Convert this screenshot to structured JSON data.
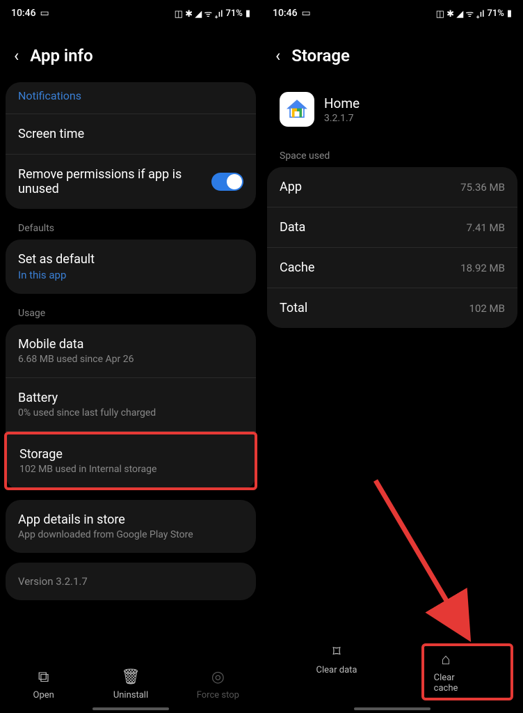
{
  "statusbar": {
    "time": "10:46",
    "battery": "71%"
  },
  "left": {
    "title": "App info",
    "notifications": "Notifications",
    "screen_time": "Screen time",
    "remove_perm": "Remove permissions if app is unused",
    "defaults_label": "Defaults",
    "set_default": "Set as default",
    "in_this_app": "In this app",
    "usage_label": "Usage",
    "mobile_data": "Mobile data",
    "mobile_data_sub": "6.68 MB used since Apr 26",
    "battery": "Battery",
    "battery_sub": "0% used since last fully charged",
    "storage": "Storage",
    "storage_sub": "102 MB used in Internal storage",
    "details": "App details in store",
    "details_sub": "App downloaded from Google Play Store",
    "version": "Version 3.2.1.7",
    "nav": {
      "open": "Open",
      "uninstall": "Uninstall",
      "force": "Force stop"
    }
  },
  "right": {
    "title": "Storage",
    "app_name": "Home",
    "app_version": "3.2.1.7",
    "space_used": "Space used",
    "rows": {
      "app": {
        "label": "App",
        "value": "75.36 MB"
      },
      "data": {
        "label": "Data",
        "value": "7.41 MB"
      },
      "cache": {
        "label": "Cache",
        "value": "18.92 MB"
      },
      "total": {
        "label": "Total",
        "value": "102 MB"
      }
    },
    "nav": {
      "clear_data": "Clear data",
      "clear_cache": "Clear cache"
    }
  }
}
